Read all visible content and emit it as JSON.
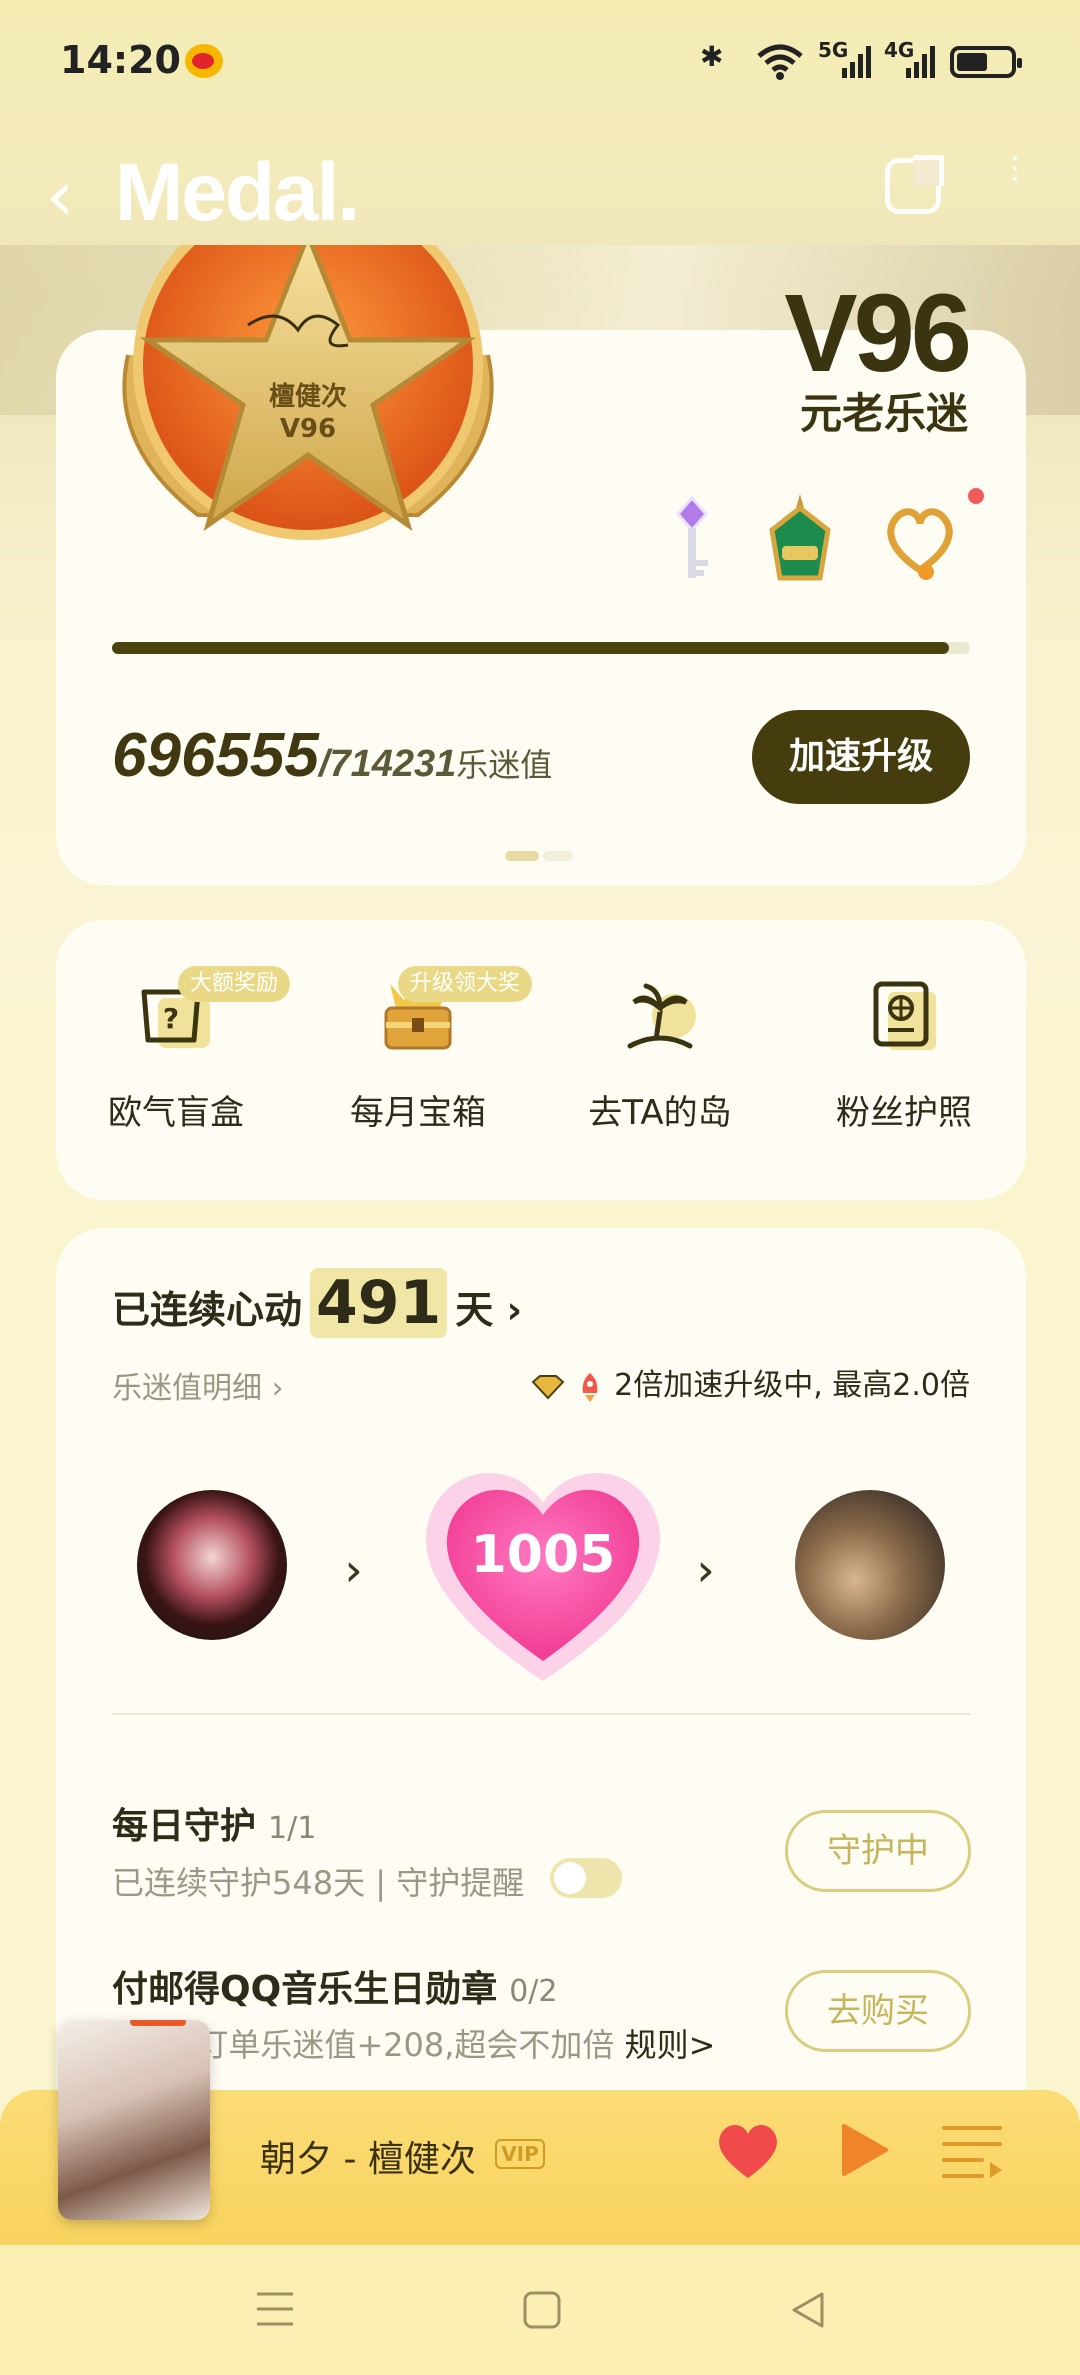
{
  "status_bar": {
    "time": "14:20",
    "bluetooth": "✱",
    "signal_5g": "5G",
    "signal_4g": "4G"
  },
  "header": {
    "back_label": "‹",
    "logo": "Medal.",
    "more_label": "⋮"
  },
  "level_card": {
    "badge_name": "檀健次",
    "badge_level": "V96",
    "level": "V96",
    "level_name": "元老乐迷",
    "progress_fraction": 0.975,
    "score_current": "696555",
    "score_total": "/714231",
    "score_unit": "乐迷值",
    "speedup_button": "加速升级",
    "charm_icons": [
      "key-charm-icon",
      "green-pendant-charm-icon",
      "heart-pendant-charm-icon"
    ]
  },
  "entries": [
    {
      "label": "欧气盲盒",
      "tag": "大额奖励",
      "icon": "mystery-box-icon"
    },
    {
      "label": "每月宝箱",
      "tag": "升级领大奖",
      "icon": "treasure-chest-icon"
    },
    {
      "label": "去TA的岛",
      "tag": "",
      "icon": "island-icon"
    },
    {
      "label": "粉丝护照",
      "tag": "",
      "icon": "passport-icon"
    }
  ],
  "heart_card": {
    "streak_prefix": "已连续心动",
    "streak_days": "491",
    "streak_suffix": "天 ›",
    "detail_link": "乐迷值明细 ›",
    "boost_text": "2倍加速升级中, 最高2.0倍",
    "heart_value": "1005"
  },
  "tasks": [
    {
      "title": "每日守护",
      "count": "1/1",
      "sub": "已连续守护548天 | 守护提醒",
      "button": "守护中"
    },
    {
      "title": "付邮得QQ音乐生日勋章",
      "count": "0/2",
      "sub": "每1笔订单乐迷值+208,超会不加倍",
      "rule": "规则>",
      "button": "去购买"
    }
  ],
  "player": {
    "song": "朝夕 - 檀健次",
    "vip_badge": "VIP"
  },
  "colors": {
    "accent_dark": "#463d0e",
    "heart_pink": "#f04aa0",
    "player_yellow": "#f9d35e",
    "play_orange": "#f0842a",
    "like_red": "#f04a4a"
  }
}
